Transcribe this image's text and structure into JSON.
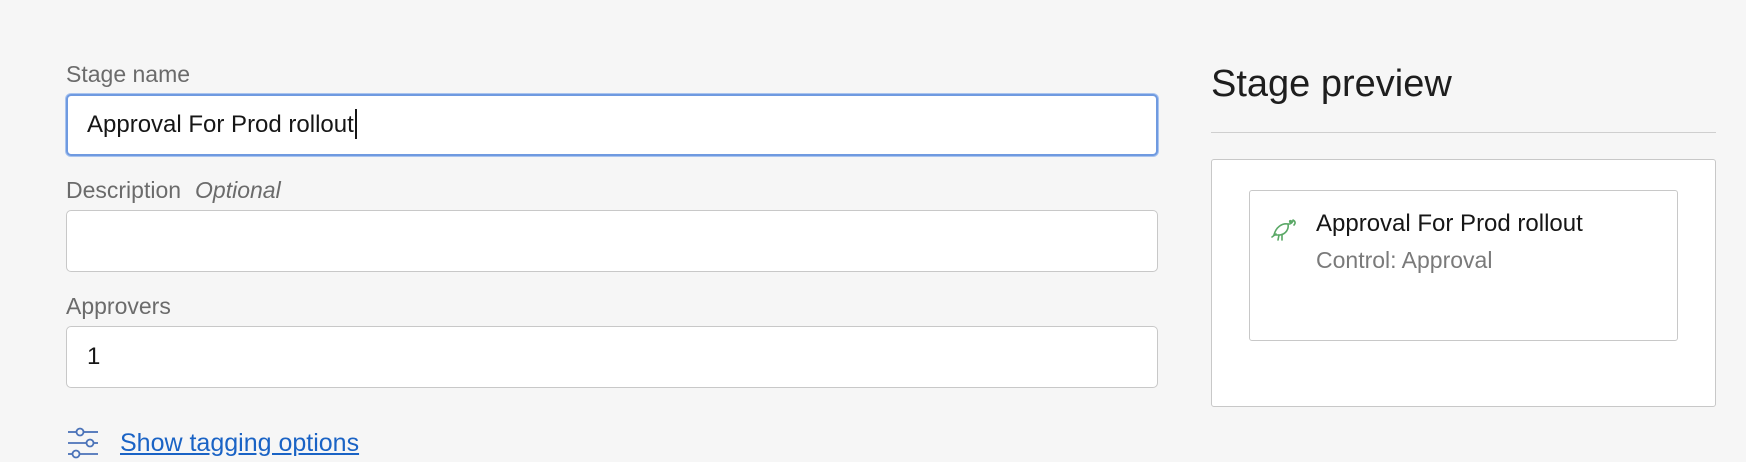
{
  "form": {
    "stage_name": {
      "label": "Stage name",
      "value": "Approval For Prod rollout"
    },
    "description": {
      "label": "Description",
      "optional_label": "Optional",
      "value": ""
    },
    "approvers": {
      "label": "Approvers",
      "value": "1"
    },
    "tagging_link": {
      "label": "Show tagging options",
      "icon": "sliders-icon"
    }
  },
  "preview": {
    "title": "Stage preview",
    "card": {
      "title": "Approval For Prod rollout",
      "subtitle": "Control: Approval",
      "icon": "bird-icon"
    }
  },
  "colors": {
    "background": "#f6f6f6",
    "focus_border": "#6f9ae0",
    "link": "#1a63c5",
    "icon_green": "#5aa866"
  }
}
